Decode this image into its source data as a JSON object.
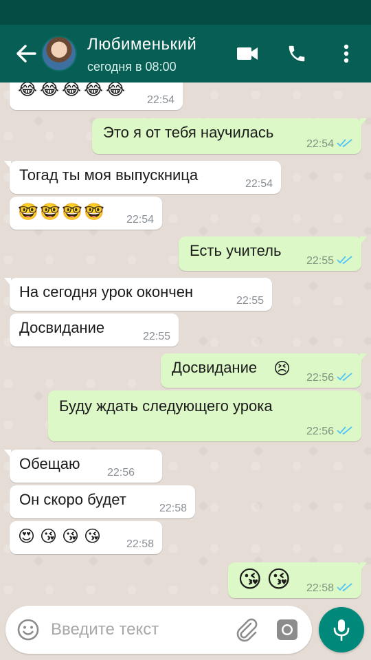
{
  "header": {
    "title": "Любименький",
    "subtitle": "сегодня в 08:00",
    "colors": {
      "bar": "#075e54",
      "statusbar": "#054d44"
    }
  },
  "messages": [
    {
      "dir": "in",
      "emoji": [
        "😂",
        "😂",
        "😂",
        "😂",
        "😂"
      ],
      "time": "22:54"
    },
    {
      "dir": "out",
      "text": "Это я от тебя научилась",
      "time": "22:54",
      "read": true
    },
    {
      "dir": "in",
      "text": "Тогад ты моя выпускница",
      "time": "22:54"
    },
    {
      "dir": "in",
      "emoji": [
        "🤓",
        "🤓",
        "🤓",
        "🤓"
      ],
      "time": "22:54"
    },
    {
      "dir": "out",
      "text": "Есть учитель",
      "time": "22:55",
      "read": true
    },
    {
      "dir": "in",
      "text": "На сегодня урок окончен",
      "time": "22:55"
    },
    {
      "dir": "in",
      "text": "Досвидание",
      "time": "22:55"
    },
    {
      "dir": "out",
      "text": "Досвидание",
      "emoji": [
        "😣"
      ],
      "time": "22:56",
      "read": true
    },
    {
      "dir": "out",
      "text": "Буду ждать следующего урока",
      "time": "22:56",
      "read": true
    },
    {
      "dir": "in",
      "text": "Обещаю",
      "time": "22:56"
    },
    {
      "dir": "in",
      "text": "Он скоро будет",
      "time": "22:58"
    },
    {
      "dir": "in",
      "emoji": [
        "😍",
        "😘",
        "😘",
        "😘"
      ],
      "time": "22:58"
    },
    {
      "dir": "out",
      "emoji": [
        "😘",
        "😘"
      ],
      "time": "22:58",
      "read": true
    }
  ],
  "composer": {
    "placeholder": "Введите текст"
  },
  "colors": {
    "incoming": "#ffffff",
    "outgoing": "#dcf8c6",
    "read_ticks": "#4fc3f7",
    "accent": "#00897b"
  }
}
